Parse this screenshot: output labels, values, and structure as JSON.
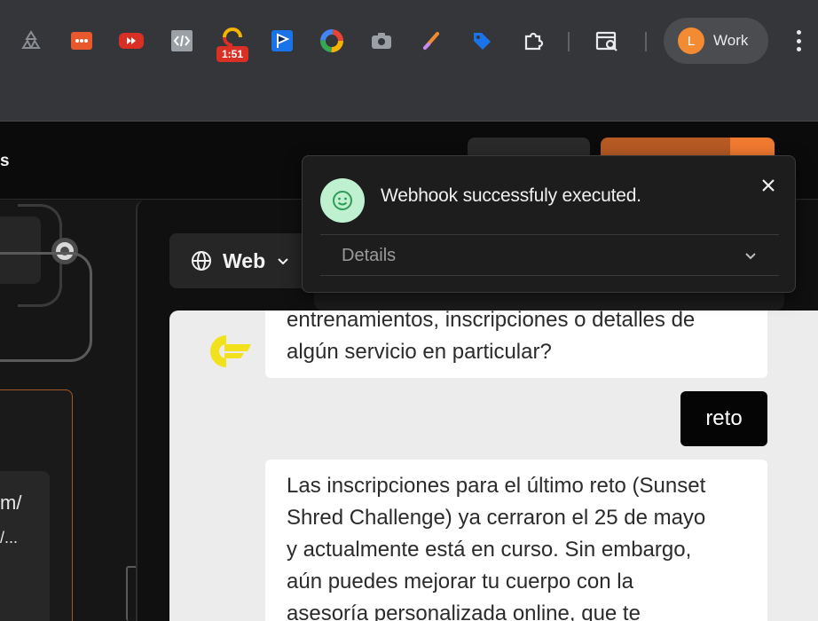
{
  "browser": {
    "extensions": [
      {
        "name": "recycle-extension-icon",
        "color": "#8a8d91"
      },
      {
        "name": "ellipsis-extension-icon",
        "color": "#e8582c"
      },
      {
        "name": "youtube-extension-icon",
        "color": "#d93025"
      },
      {
        "name": "code-extension-icon",
        "color": "#9aa0a6"
      },
      {
        "name": "timer-extension-icon",
        "color": "#d93025",
        "badge": "1:51"
      },
      {
        "name": "flag-extension-icon",
        "color": "#1a73e8"
      },
      {
        "name": "color-wheel-extension-icon",
        "color": "#f4b400"
      },
      {
        "name": "camera-extension-icon",
        "color": "#9aa0a6"
      },
      {
        "name": "pen-extension-icon",
        "color": "#f28b32"
      },
      {
        "name": "tag-extension-icon",
        "color": "#1a73e8"
      },
      {
        "name": "puzzle-extension-icon",
        "color": "#e8eaed"
      },
      {
        "name": "search-tab-icon",
        "color": "#e8eaed"
      }
    ],
    "profile": {
      "initial": "L",
      "name": "Work"
    }
  },
  "app": {
    "header_crumb": "s"
  },
  "canvas": {
    "node_lines": [
      "m/",
      "/..."
    ]
  },
  "preview": {
    "channel_label": "Web"
  },
  "chat": {
    "messages": [
      {
        "role": "bot",
        "lines": [
          "entrenamientos, inscripciones o detalles de",
          "algún servicio en particular?"
        ]
      },
      {
        "role": "user",
        "text": "reto"
      },
      {
        "role": "bot",
        "lines": [
          "Las inscripciones para el último reto (Sunset",
          "Shred Challenge) ya cerraron el 25 de mayo",
          "y actualmente está en curso. Sin embargo,",
          "aún puedes mejorar tu cuerpo con la",
          "asesoría personalizada online, que te"
        ]
      }
    ]
  },
  "toast": {
    "message": "Webhook successfuly executed.",
    "details_label": "Details"
  },
  "colors": {
    "accent_orange": "#f07a30",
    "success_green": "#bff0cf",
    "logo_yellow": "#f2e21e"
  }
}
